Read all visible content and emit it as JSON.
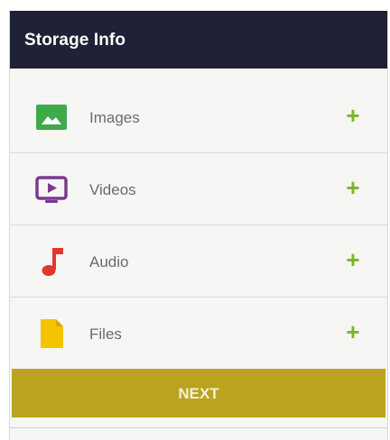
{
  "header": {
    "title": "Storage Info"
  },
  "items": [
    {
      "label": "Images",
      "icon": "image-icon",
      "color": "#3eaa4a",
      "action": "+"
    },
    {
      "label": "Videos",
      "icon": "video-player-icon",
      "color": "#7b3a8e",
      "action": "+"
    },
    {
      "label": "Audio",
      "icon": "music-note-icon",
      "color": "#e2382b",
      "action": "+"
    },
    {
      "label": "Files",
      "icon": "file-icon",
      "color": "#f5c400",
      "action": "+"
    }
  ],
  "footer": {
    "next_label": "NEXT"
  },
  "colors": {
    "header_bg": "#1f2236",
    "accent_plus": "#79b62c",
    "next_button": "#bba31f"
  }
}
